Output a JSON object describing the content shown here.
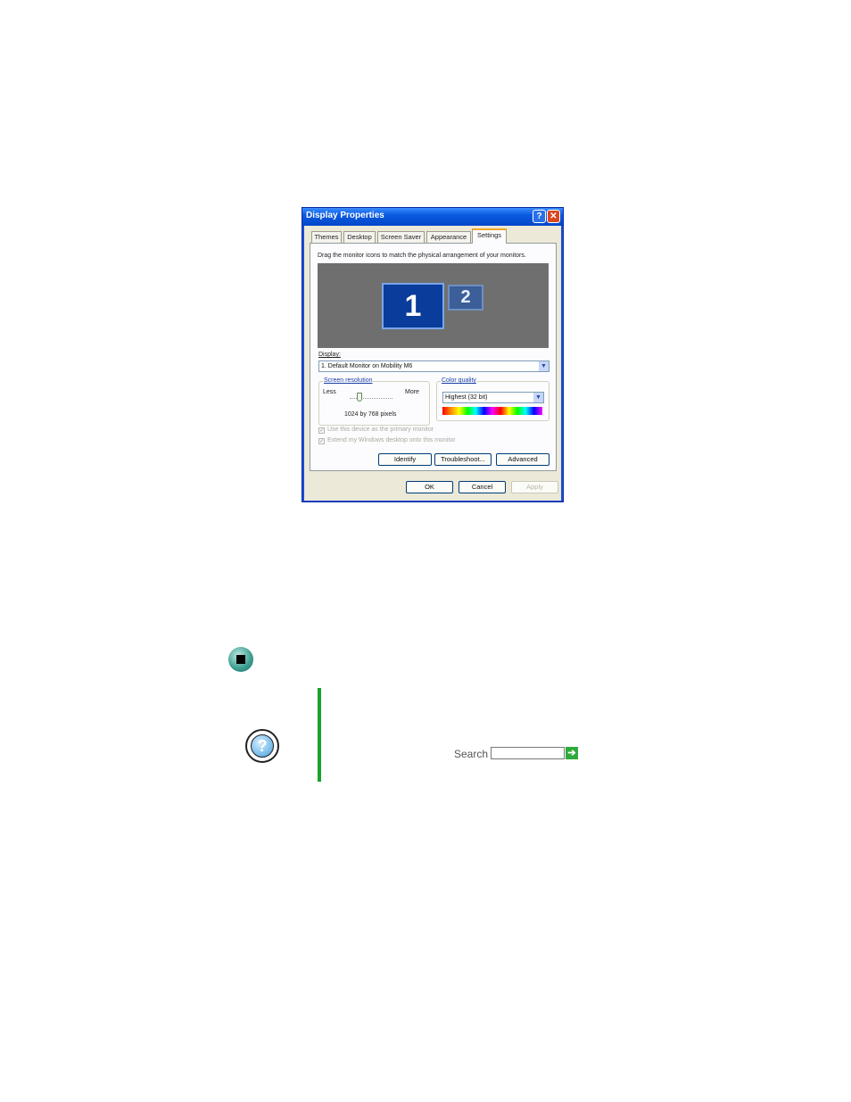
{
  "dialog": {
    "title": "Display Properties",
    "help_glyph": "?",
    "close_glyph": "✕",
    "tabs": [
      "Themes",
      "Desktop",
      "Screen Saver",
      "Appearance",
      "Settings"
    ],
    "active_tab": "Settings",
    "instruction": "Drag the monitor icons to match the physical arrangement of your monitors.",
    "monitors": [
      "1",
      "2"
    ],
    "display_label": "Display:",
    "display_value": "1. Default Monitor on Mobility M6",
    "screen_resolution": {
      "title": "Screen resolution",
      "less": "Less",
      "more": "More",
      "value_text": "1024 by 768 pixels"
    },
    "color_quality": {
      "title": "Color quality",
      "value": "Highest (32 bit)"
    },
    "checkboxes": [
      "Use this device as the primary monitor",
      "Extend my Windows desktop onto this monitor"
    ],
    "buttons": {
      "identify": "Identify",
      "troubleshoot": "Troubleshoot...",
      "advanced": "Advanced",
      "ok": "OK",
      "cancel": "Cancel",
      "apply": "Apply"
    }
  },
  "search": {
    "label": "Search",
    "go_glyph": "➔"
  },
  "icons": {
    "stop": "stop-icon",
    "help": "help-icon",
    "help_glyph": "?"
  },
  "colors": {
    "title_bar": "#0a5ae0",
    "accent_green": "#1aa32a"
  }
}
